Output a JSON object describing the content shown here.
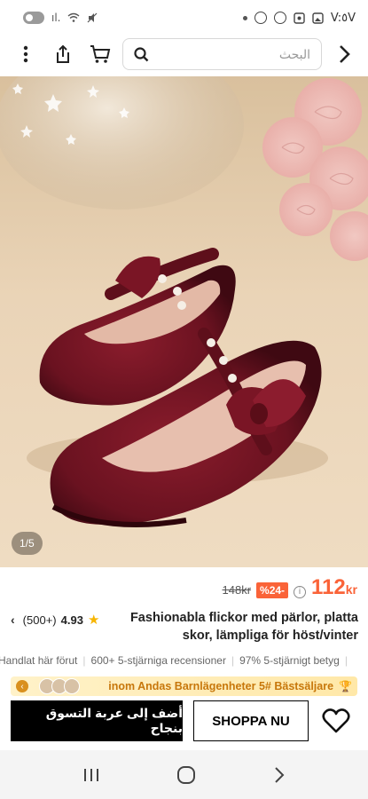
{
  "status_bar": {
    "time": "V:٥V",
    "signal_text": "ıl."
  },
  "header": {
    "search_placeholder": "البحث",
    "icons": [
      "more-vertical-icon",
      "share-icon",
      "cart-icon",
      "search-icon",
      "chevron-right-icon"
    ]
  },
  "gallery": {
    "counter": "1/5"
  },
  "price": {
    "old": "148kr",
    "discount": "%24-",
    "current": "112",
    "currency": "kr"
  },
  "product": {
    "title": "Fashionabla flickor med pärlor, platta skor, lämpliga för höst/vinter",
    "reviews_count": "(500+)",
    "rating": "4.93"
  },
  "badges": [
    "Handlat här förut",
    "600+ 5-stjärniga recensioner",
    "97% 5-stjärnigt betyg"
  ],
  "promo": {
    "text": "inom Andas Barnlägenheter  5# Bästsäljare"
  },
  "actions": {
    "add_to_cart": "أضف إلى عربة التسوق بنجاح",
    "shop_now": "SHOPPA NU"
  },
  "colors": {
    "accent": "#fa6338",
    "star": "#f7b500",
    "promo_text": "#c7770b",
    "shoe": "#6e1320"
  }
}
